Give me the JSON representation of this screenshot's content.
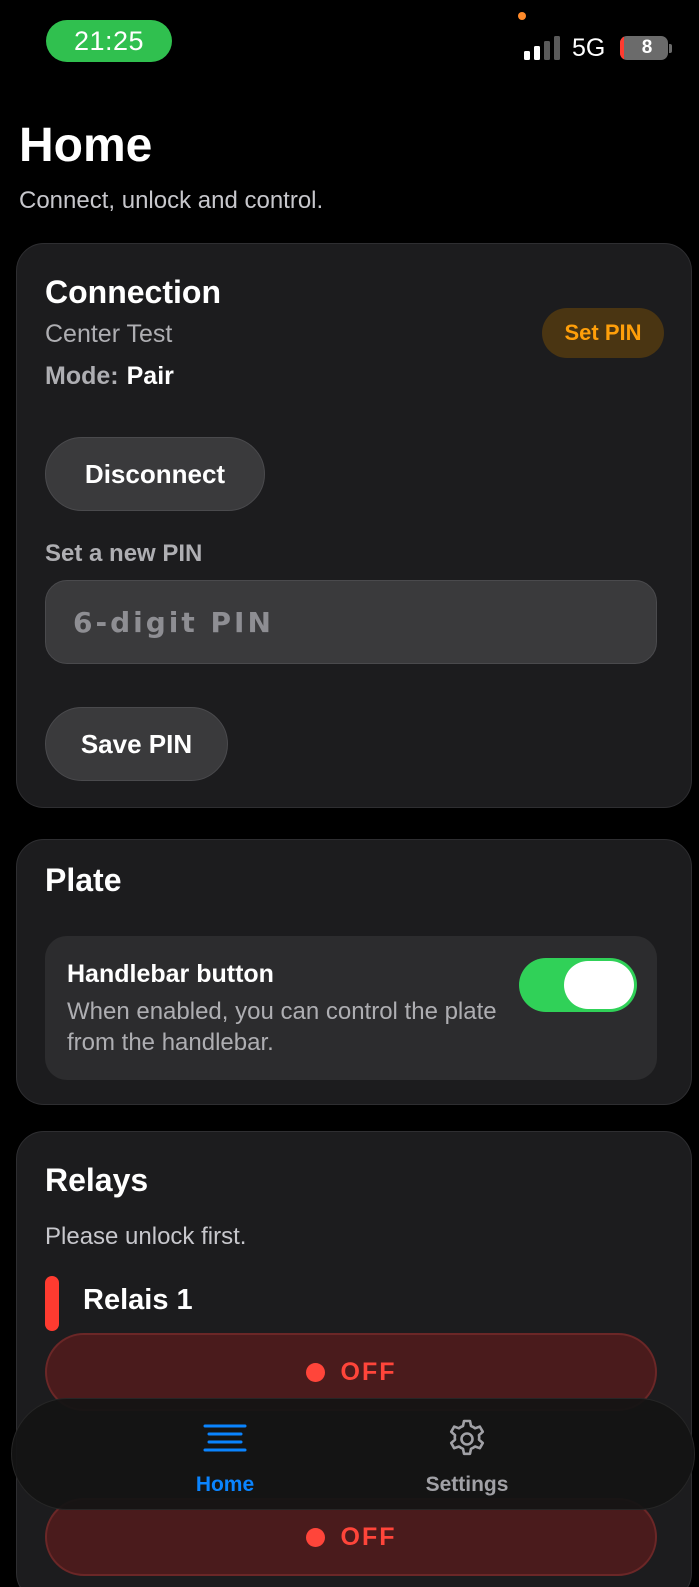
{
  "status_bar": {
    "time": "21:25",
    "network": "5G",
    "battery": "8",
    "battery_level": 0.08,
    "signal_bars_active": 2,
    "signal_bars_total": 4
  },
  "header": {
    "title": "Home",
    "subtitle": "Connect, unlock and control."
  },
  "connection": {
    "title": "Connection",
    "device_name": "Center Test",
    "mode_label": "Mode:",
    "mode_value": "Pair",
    "set_pin_badge": "Set PIN",
    "disconnect_label": "Disconnect",
    "new_pin_label": "Set a new PIN",
    "pin_placeholder": "6-digit PIN",
    "pin_value": "",
    "save_pin_label": "Save PIN"
  },
  "plate": {
    "title": "Plate",
    "handlebar_title": "Handlebar button",
    "handlebar_desc": "When enabled, you can control the plate from the handlebar.",
    "handlebar_enabled": true
  },
  "relays": {
    "title": "Relays",
    "hint": "Please unlock first.",
    "items": [
      {
        "name": "Relais 1",
        "state": "OFF"
      },
      {
        "name": "",
        "state": "OFF"
      }
    ]
  },
  "tab_bar": {
    "items": [
      {
        "label": "Home",
        "icon": "home-lines-icon",
        "active": true
      },
      {
        "label": "Settings",
        "icon": "gear-icon",
        "active": false
      }
    ]
  },
  "colors": {
    "accent_blue": "#0a84ff",
    "toggle_green": "#30d158",
    "relay_red": "#ff453a",
    "badge_orange": "#ff9f0a",
    "time_pill_green": "#30c04f"
  }
}
